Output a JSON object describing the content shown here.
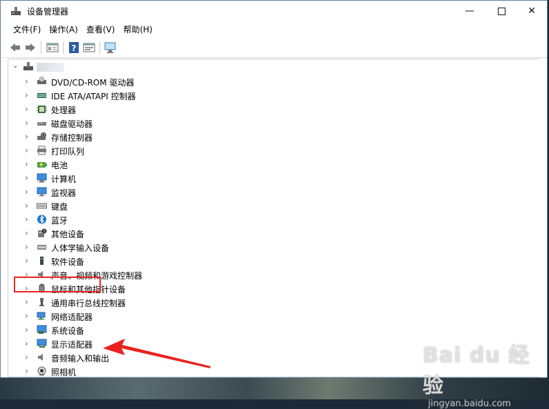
{
  "window": {
    "title": "设备管理器",
    "controls": {
      "minimize": "—",
      "close": "✕"
    }
  },
  "menu": [
    {
      "label": "文件(F)"
    },
    {
      "label": "操作(A)"
    },
    {
      "label": "查看(V)"
    },
    {
      "label": "帮助(H)"
    }
  ],
  "toolbar": {
    "buttons": [
      "back-icon",
      "forward-icon",
      "properties-icon",
      "help-icon",
      "update-driver-icon",
      "scan-hardware-icon"
    ]
  },
  "tree": {
    "root_chevron": "⌄",
    "collapsed_chevron": "›",
    "items": [
      {
        "label": "DVD/CD-ROM 驱动器",
        "icon": "dvd-drive-icon"
      },
      {
        "label": "IDE ATA/ATAPI 控制器",
        "icon": "ide-controller-icon"
      },
      {
        "label": "处理器",
        "icon": "processor-icon"
      },
      {
        "label": "磁盘驱动器",
        "icon": "disk-drive-icon"
      },
      {
        "label": "存储控制器",
        "icon": "storage-controller-icon"
      },
      {
        "label": "打印队列",
        "icon": "printer-icon"
      },
      {
        "label": "电池",
        "icon": "battery-icon"
      },
      {
        "label": "计算机",
        "icon": "computer-icon"
      },
      {
        "label": "监视器",
        "icon": "monitor-icon"
      },
      {
        "label": "键盘",
        "icon": "keyboard-icon"
      },
      {
        "label": "蓝牙",
        "icon": "bluetooth-icon"
      },
      {
        "label": "其他设备",
        "icon": "other-devices-icon"
      },
      {
        "label": "人体学输入设备",
        "icon": "hid-icon"
      },
      {
        "label": "软件设备",
        "icon": "software-device-icon"
      },
      {
        "label": "声音、视频和游戏控制器",
        "icon": "speaker-icon"
      },
      {
        "label": "鼠标和其他指针设备",
        "icon": "mouse-icon"
      },
      {
        "label": "通用串行总线控制器",
        "icon": "usb-icon"
      },
      {
        "label": "网络适配器",
        "icon": "network-adapter-icon"
      },
      {
        "label": "系统设备",
        "icon": "system-device-icon"
      },
      {
        "label": "显示适配器",
        "icon": "display-adapter-icon"
      },
      {
        "label": "音频输入和输出",
        "icon": "audio-io-icon"
      },
      {
        "label": "照相机",
        "icon": "camera-icon"
      }
    ]
  },
  "watermark": {
    "main": "Bai du 经验",
    "sub": "jingyan.baidu.com"
  },
  "colors": {
    "highlight": "#e8231f",
    "monitor": "#3d8ee0",
    "accent": "#1a73c8"
  }
}
